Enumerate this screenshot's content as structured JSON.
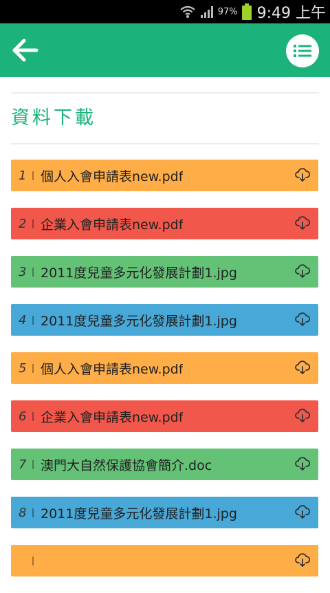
{
  "status_bar": {
    "battery": "97%",
    "time": "9:49 上午"
  },
  "header": {
    "back_icon": "arrow-left-icon",
    "menu_icon": "list-icon",
    "accent_color": "#1bb37a"
  },
  "page": {
    "title": "資料下載"
  },
  "files": [
    {
      "num": "1",
      "name": "個人入會申請表new.pdf",
      "color": "#ffad47"
    },
    {
      "num": "2",
      "name": "企業入會申請表new.pdf",
      "color": "#f1574a"
    },
    {
      "num": "3",
      "name": "2011度兒童多元化發展計劃1.jpg",
      "color": "#64c277"
    },
    {
      "num": "4",
      "name": "2011度兒童多元化發展計劃1.jpg",
      "color": "#48a8d7"
    },
    {
      "num": "5",
      "name": "個人入會申請表new.pdf",
      "color": "#ffad47"
    },
    {
      "num": "6",
      "name": "企業入會申請表new.pdf",
      "color": "#f1574a"
    },
    {
      "num": "7",
      "name": "澳門大自然保護協會簡介.doc",
      "color": "#64c277"
    },
    {
      "num": "8",
      "name": "2011度兒童多元化發展計劃1.jpg",
      "color": "#48a8d7"
    },
    {
      "num": "",
      "name": "",
      "color": "#ffad47"
    }
  ]
}
